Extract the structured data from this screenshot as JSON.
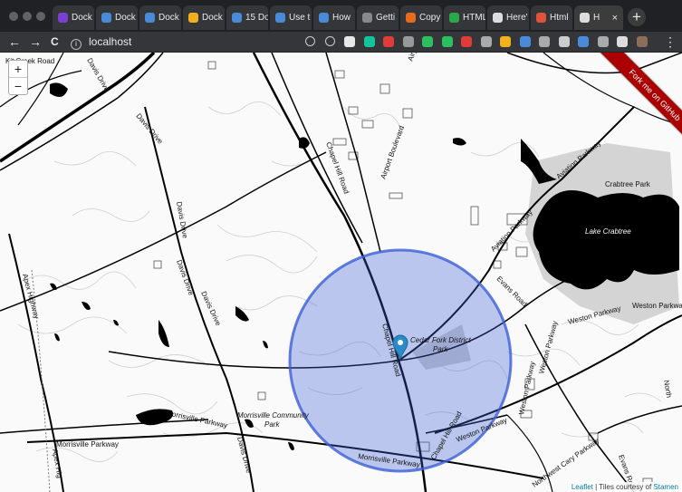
{
  "browser": {
    "tabs": [
      {
        "label": "Dock",
        "icon": "webflow-w-icon",
        "color": "#7b3fd1"
      },
      {
        "label": "Dock",
        "icon": "globe-icon",
        "color": "#4a8bd9"
      },
      {
        "label": "Dock",
        "icon": "globe-icon",
        "color": "#4a8bd9"
      },
      {
        "label": "Dock",
        "icon": "sync-icon",
        "color": "#f2b01e"
      },
      {
        "label": "15 Do",
        "icon": "document-icon",
        "color": "#4a8bd9"
      },
      {
        "label": "Use t",
        "icon": "globe-icon",
        "color": "#4a8bd9"
      },
      {
        "label": "How",
        "icon": "spinner-icon",
        "color": "#4a8bd9"
      },
      {
        "label": "Getti",
        "icon": "circle-icon",
        "color": "#888888"
      },
      {
        "label": "Copy",
        "icon": "flame-icon",
        "color": "#e76b1e"
      },
      {
        "label": "HTML",
        "icon": "code-icon",
        "color": "#2aa84a"
      },
      {
        "label": "Here'",
        "icon": "globe-icon",
        "color": "#dddddd"
      },
      {
        "label": "Html",
        "icon": "infinity-icon",
        "color": "#e0533a"
      },
      {
        "label": "H",
        "icon": "globe-icon",
        "color": "#dddddd",
        "active": true
      }
    ],
    "new_tab": "+",
    "tab_close": "×",
    "address": "localhost",
    "info_glyph": "i",
    "back": "←",
    "forward": "→",
    "reload": "C",
    "menu": "⋮"
  },
  "extensions": [
    {
      "icon": "target-icon",
      "color": "#cccccc"
    },
    {
      "icon": "star-icon",
      "color": "#cccccc"
    },
    {
      "icon": "record-icon",
      "color": "#e8e8e8"
    },
    {
      "icon": "grammarly-icon",
      "color": "#15c39a"
    },
    {
      "icon": "red-circle-icon",
      "color": "#e03a3a"
    },
    {
      "icon": "info-icon",
      "color": "#999999"
    },
    {
      "icon": "evernote-icon",
      "color": "#2dbe60"
    },
    {
      "icon": "badge-icon",
      "color": "#2dbe60"
    },
    {
      "icon": "stack-icon",
      "color": "#e03a3a"
    },
    {
      "icon": "gear-icon",
      "color": "#aaaaaa"
    },
    {
      "icon": "color-icon",
      "color": "#f2b01e"
    },
    {
      "icon": "palette-icon",
      "color": "#4a8bd9"
    },
    {
      "icon": "wappalyzer-icon",
      "color": "#aaaaaa"
    },
    {
      "icon": "download-icon",
      "color": "#cccccc"
    },
    {
      "icon": "gmail-icon",
      "color": "#4a8bd9"
    },
    {
      "icon": "screenshot-icon",
      "color": "#aaaaaa"
    },
    {
      "icon": "chat-icon",
      "color": "#dddddd"
    },
    {
      "icon": "avatar-icon",
      "color": "#8a6d5b"
    }
  ],
  "map": {
    "zoom_in": "+",
    "zoom_out": "−",
    "ribbon": "Fork me on GitHub",
    "attribution_link": "Leaflet",
    "attribution_text": " | Tiles courtesy of ",
    "attribution_link2": "Stamen",
    "circle_color": "#3b5fd6",
    "marker_color": "#2a8cc7",
    "labels": {
      "kit_creek": "Kit Creek Road",
      "davis_1": "Davis Drive",
      "davis_2": "Davis Drive",
      "davis_3": "Davis Drive",
      "davis_4": "Davis Drive",
      "chapel_hill_1": "Chapel Hill Road",
      "chapel_hill_2": "Chapel Hill Road",
      "chapel_hill_3": "Chapel Hill Road",
      "airport": "Airport Boulevard",
      "aviation_1": "Aviation Parkway",
      "aviation_2": "Aviation Parkway",
      "crabtree_park": "Crabtree Park",
      "lake_crabtree": "Lake Crabtree",
      "evans_1": "Evans Road",
      "evans_2": "Evans Road",
      "weston_1": "Weston Parkway",
      "weston_2": "Weston Parkway",
      "weston_3": "Weston Parkway",
      "weston_4": "Weston Parkway",
      "cedar_fork": "Cedar Fork District",
      "park": "Park",
      "apex_1": "Apex Highway",
      "apex_2": "Apex Hig",
      "morrisville_1": "Morrisville Parkway",
      "morrisville_2": "Morrisville Parkway",
      "morrisville_3": "Morrisville Parkway",
      "morrisville_community": "Morrisville Community",
      "northwest_cary": "Northwest Cary Parkway",
      "north": "North",
      "fa": "Fa",
      "nw": "Nw"
    }
  }
}
